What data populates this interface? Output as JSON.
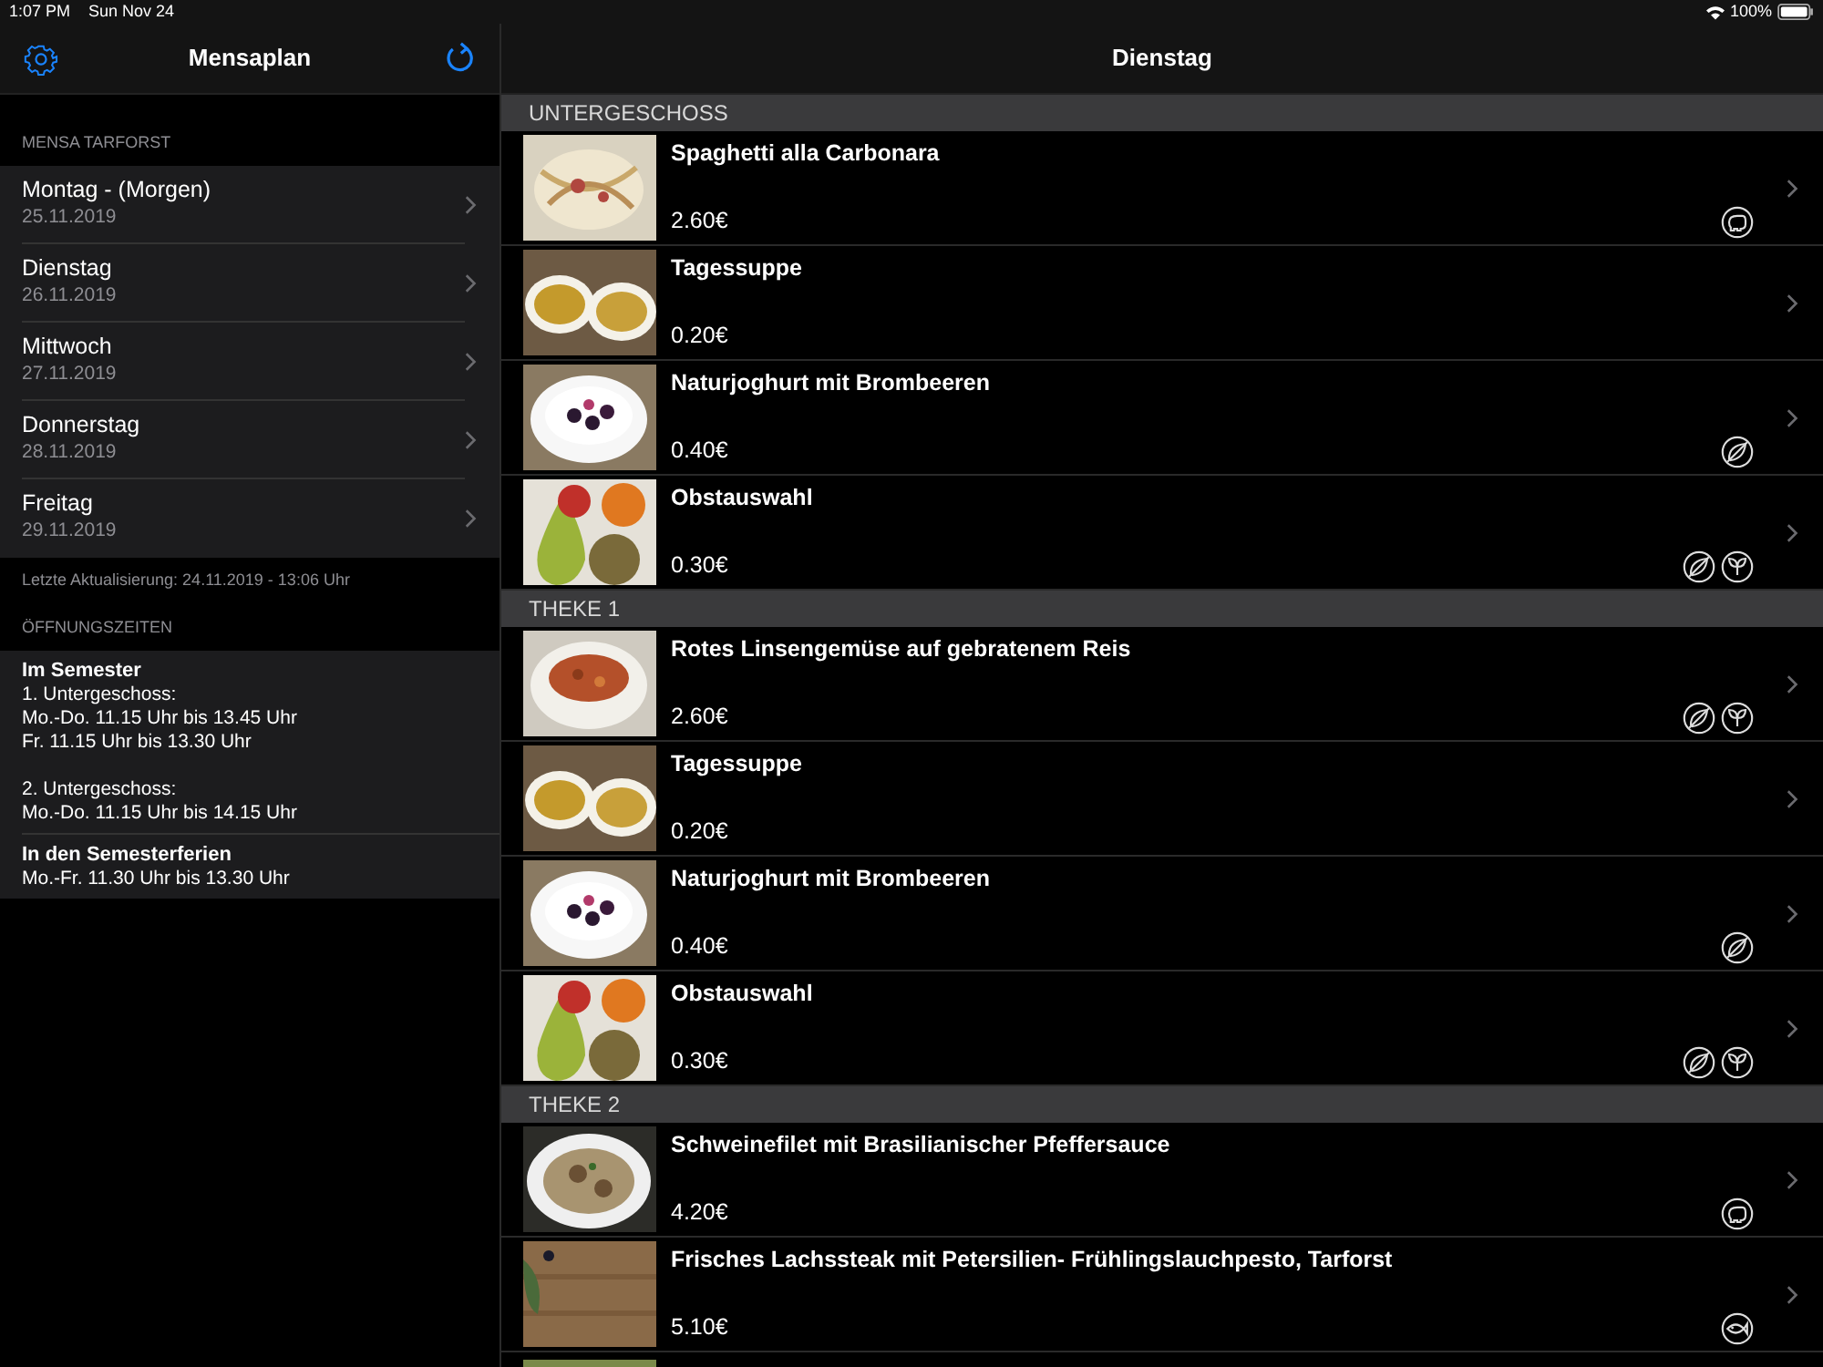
{
  "status_bar": {
    "time": "1:07 PM",
    "date": "Sun Nov 24",
    "battery": "100%"
  },
  "sidebar": {
    "title": "Mensaplan",
    "section": "MENSA TARFORST",
    "days": [
      {
        "name": "Montag - (Morgen)",
        "date": "25.11.2019"
      },
      {
        "name": "Dienstag",
        "date": "26.11.2019"
      },
      {
        "name": "Mittwoch",
        "date": "27.11.2019"
      },
      {
        "name": "Donnerstag",
        "date": "28.11.2019"
      },
      {
        "name": "Freitag",
        "date": "29.11.2019"
      }
    ],
    "last_update": "Letzte Aktualisierung: 24.11.2019 - 13:06 Uhr",
    "hours_section": "ÖFFNUNGSZEITEN",
    "hours": [
      {
        "title": "Im Semester",
        "blocks": [
          [
            "1. Untergeschoss:",
            "Mo.-Do. 11.15 Uhr bis 13.45 Uhr",
            "Fr. 11.15 Uhr bis 13.30 Uhr"
          ],
          [
            "2. Untergeschoss:",
            "Mo.-Do. 11.15 Uhr bis 14.15 Uhr"
          ]
        ]
      },
      {
        "title": "In den Semesterferien",
        "blocks": [
          [
            "Mo.-Fr. 11.30 Uhr bis 13.30 Uhr"
          ]
        ]
      }
    ]
  },
  "main": {
    "title": "Dienstag",
    "sections": [
      {
        "title": "UNTERGESCHOSS",
        "dishes": [
          {
            "name": "Spaghetti alla Carbonara",
            "price": "2.60€",
            "badges": [
              {
                "kind": "pork"
              }
            ]
          },
          {
            "name": "Tagessuppe",
            "price": "0.20€"
          },
          {
            "name": "Naturjoghurt mit Brombeeren",
            "price": "0.40€",
            "badges": [
              {
                "kind": "crossed-leaf"
              }
            ]
          },
          {
            "name": "Obstauswahl",
            "price": "0.30€",
            "badges": [
              {
                "kind": "crossed-leaf"
              },
              {
                "kind": "sprout"
              }
            ]
          }
        ]
      },
      {
        "title": "THEKE 1",
        "dishes": [
          {
            "name": "Rotes Linsengemüse auf gebratenem Reis",
            "price": "2.60€",
            "badges": [
              {
                "kind": "crossed-leaf"
              },
              {
                "kind": "sprout"
              }
            ]
          },
          {
            "name": "Tagessuppe",
            "price": "0.20€"
          },
          {
            "name": "Naturjoghurt mit Brombeeren",
            "price": "0.40€",
            "badges": [
              {
                "kind": "crossed-leaf"
              }
            ]
          },
          {
            "name": "Obstauswahl",
            "price": "0.30€",
            "badges": [
              {
                "kind": "crossed-leaf"
              },
              {
                "kind": "sprout"
              }
            ]
          }
        ]
      },
      {
        "title": "THEKE 2",
        "dishes": [
          {
            "name": "Schweinefilet mit Brasilianischer Pfeffersauce",
            "price": "4.20€",
            "badges": [
              {
                "kind": "pork"
              }
            ]
          },
          {
            "name": "Frisches Lachssteak mit Petersilien- Frühlingslauchpesto, Tarforst",
            "price": "5.10€",
            "badges": [
              {
                "kind": "fish"
              }
            ]
          }
        ]
      }
    ]
  }
}
